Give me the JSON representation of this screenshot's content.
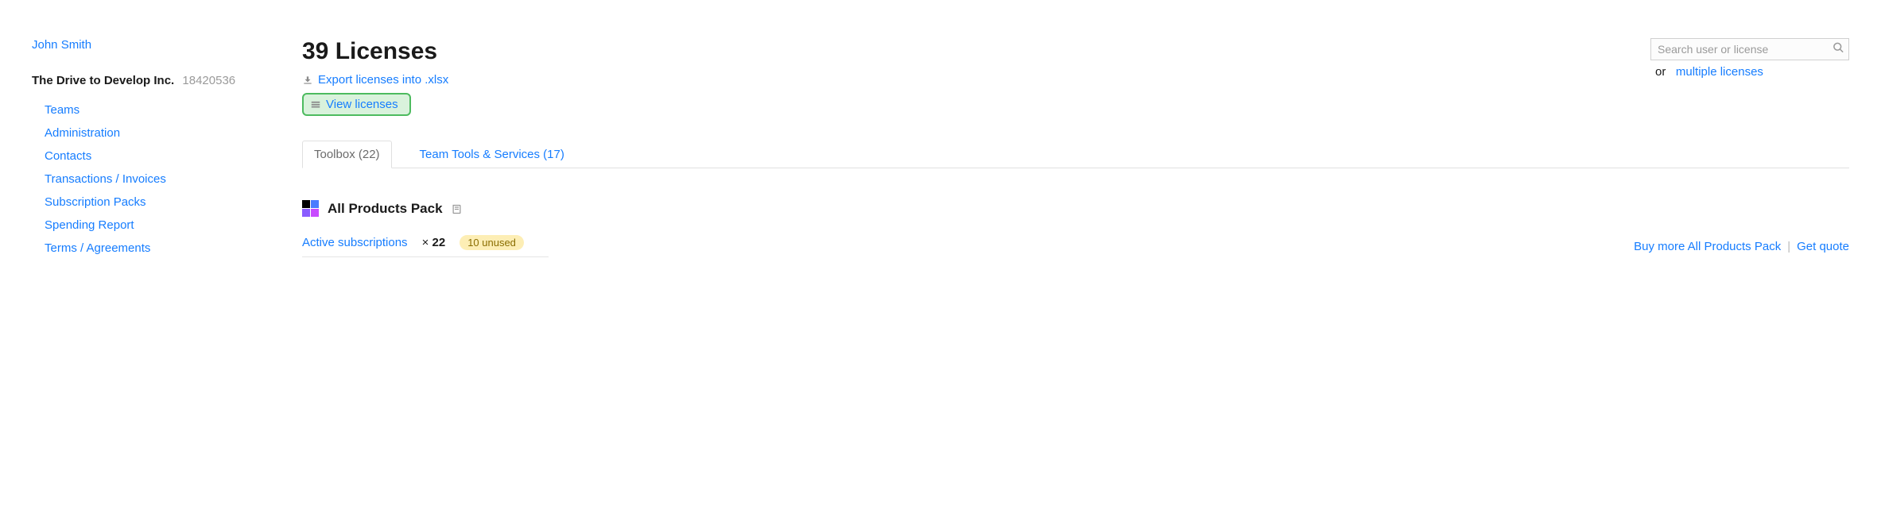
{
  "user": {
    "name": "John Smith"
  },
  "org": {
    "name": "The Drive to Develop Inc.",
    "id": "18420536"
  },
  "nav": {
    "items": [
      {
        "label": "Teams"
      },
      {
        "label": "Administration"
      },
      {
        "label": "Contacts"
      },
      {
        "label": "Transactions / Invoices"
      },
      {
        "label": "Subscription Packs"
      },
      {
        "label": "Spending Report"
      },
      {
        "label": "Terms / Agreements"
      }
    ]
  },
  "page": {
    "title": "39 Licenses"
  },
  "actions": {
    "export_label": "Export licenses into .xlsx",
    "view_label": "View licenses"
  },
  "search": {
    "placeholder": "Search user or license",
    "or_text": "or",
    "multi_label": "multiple licenses"
  },
  "tabs": [
    {
      "label": "Toolbox (22)",
      "active": true
    },
    {
      "label": "Team Tools & Services (17)",
      "active": false
    }
  ],
  "product": {
    "name": "All Products Pack",
    "active_sub_label": "Active subscriptions",
    "count_prefix": "×",
    "count": "22",
    "unused_badge": "10 unused",
    "buy_more": "Buy more All Products Pack",
    "get_quote": "Get quote"
  }
}
